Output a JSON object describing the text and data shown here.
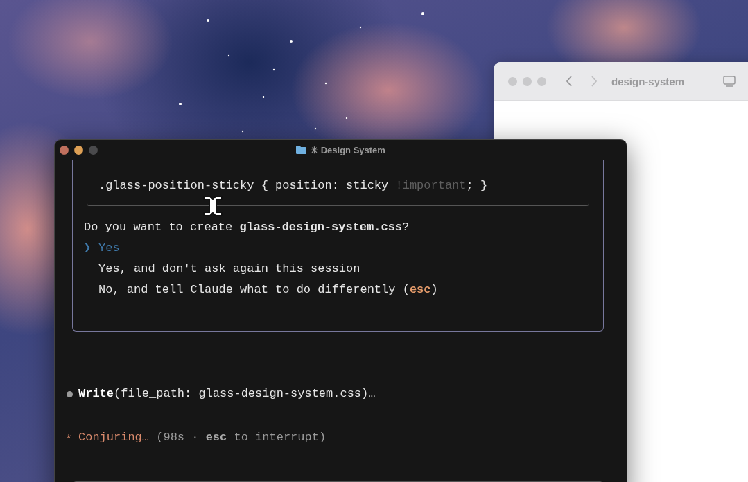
{
  "browser_window": {
    "title": "design-system"
  },
  "terminal_window": {
    "title": "✳ Design System",
    "code_line": [
      {
        "text": ".glass-position-sticky { position: sticky ",
        "kind": "plain"
      },
      {
        "text": "!important",
        "kind": "dim"
      },
      {
        "text": "; }",
        "kind": "plain"
      }
    ],
    "question": "Do you want to create **glass-design-system.css**?",
    "marker": "❯",
    "options": [
      {
        "selected": true,
        "label": [
          {
            "text": "Yes",
            "kind": "plain"
          }
        ]
      },
      {
        "selected": false,
        "label": [
          {
            "text": "Yes, and don't ask again this session",
            "kind": "plain"
          }
        ]
      },
      {
        "selected": false,
        "label": [
          {
            "text": "No, and tell Claude what to do differently (",
            "kind": "plain"
          },
          {
            "text": "esc",
            "kind": "key"
          },
          {
            "text": ")",
            "kind": "plain"
          }
        ]
      }
    ],
    "tool_line": [
      {
        "text": "Write",
        "kind": "bold"
      },
      {
        "text": "(file_path: glass-design-system.css)…",
        "kind": "plain"
      }
    ],
    "status_line": {
      "spinner": "*",
      "segments": [
        {
          "text": "Conjuring…",
          "kind": "accent"
        },
        {
          "text": " (98s · ",
          "kind": "muted"
        },
        {
          "text": "esc",
          "kind": "muted_bold"
        },
        {
          "text": " to interrupt)",
          "kind": "muted"
        }
      ]
    }
  }
}
